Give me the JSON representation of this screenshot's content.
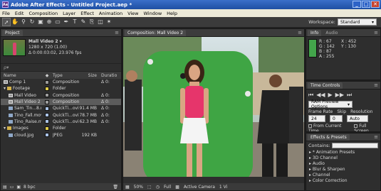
{
  "window": {
    "title": "Adobe After Effects - Untitled Project.aep *",
    "controls": [
      "_",
      "□",
      "✕"
    ]
  },
  "menu": [
    "File",
    "Edit",
    "Composition",
    "Layer",
    "Effect",
    "Animation",
    "View",
    "Window",
    "Help"
  ],
  "toolbar": {
    "tools": [
      "arrow-tool-icon",
      "hand-tool-icon",
      "zoom-tool-icon",
      "rotate-tool-icon",
      "camera-tool-icon",
      "pan-behind-icon",
      "mask-tool-icon",
      "pen-tool-icon",
      "text-tool-icon",
      "brush-tool-icon",
      "clone-tool-icon",
      "eraser-tool-icon",
      "puppet-tool-icon"
    ],
    "workspace_label": "Workspace:",
    "workspace_value": "Standard"
  },
  "project": {
    "tab": "Project",
    "selected_name": "Mall Video 2 ▾",
    "selected_meta": [
      "1280 x 720 (1.00)",
      "Δ 0:00:03:02, 23.976 fps"
    ],
    "search_placeholder": "ρ▾",
    "columns": {
      "name": "Name",
      "type": "Type",
      "size": "Size",
      "duration": "Duratio"
    },
    "rows": [
      {
        "name": "Comp 1",
        "type": "Composition",
        "size": "",
        "duration": "Δ 0:",
        "icon": "comp",
        "label_color": "#9b9b9b",
        "indent": 0,
        "selected": false
      },
      {
        "name": "Footage",
        "type": "Folder",
        "size": "",
        "duration": "",
        "icon": "folder",
        "label_color": "#e0cc48",
        "indent": 0,
        "selected": false
      },
      {
        "name": "Mall Video",
        "type": "Composition",
        "size": "",
        "duration": "Δ 0:",
        "icon": "comp",
        "label_color": "#9b9b9b",
        "indent": 1,
        "selected": false
      },
      {
        "name": "Mall Video 2",
        "type": "Composition",
        "size": "",
        "duration": "Δ 0:",
        "icon": "comp",
        "label_color": "#9b9b9b",
        "indent": 1,
        "selected": true
      },
      {
        "name": "Sam_Tin...8.mov",
        "type": "QuickTi...ovie",
        "size": "91.4 MB",
        "duration": "Δ 0:",
        "icon": "file",
        "label_color": "#a9c2e6",
        "indent": 1,
        "selected": false
      },
      {
        "name": "Tino_Fall.mov",
        "type": "QuickTi...ovie",
        "size": "78.7 MB",
        "duration": "Δ 0:",
        "icon": "file",
        "label_color": "#a9c2e6",
        "indent": 1,
        "selected": false
      },
      {
        "name": "Tino_Raise.mov",
        "type": "QuickTi...ovie",
        "size": "62.3 MB",
        "duration": "Δ 0:",
        "icon": "file",
        "label_color": "#a9c2e6",
        "indent": 1,
        "selected": false
      },
      {
        "name": "Images",
        "type": "Folder",
        "size": "",
        "duration": "",
        "icon": "folder",
        "label_color": "#e0cc48",
        "indent": 0,
        "selected": false
      },
      {
        "name": "cloud.jpg",
        "type": "JPEG",
        "size": "192 KB",
        "duration": "",
        "icon": "file",
        "label_color": "#a9c2e6",
        "indent": 1,
        "selected": false
      }
    ],
    "footer_bpc": "8 bpc"
  },
  "composition": {
    "tab": "Composition: Mall Video 2",
    "footer": {
      "zoom": "50%",
      "quality": "Full",
      "camera": "Active Camera",
      "views": "1 Vi"
    }
  },
  "info": {
    "tabs": [
      "Info",
      "Audio"
    ],
    "rgb": [
      "R : 67",
      "G : 142",
      "B : 87",
      "A : 255"
    ],
    "xy": [
      "X : 452",
      "Y : 130"
    ],
    "swatch": "#43a54b"
  },
  "time_controls": {
    "tab": "Time Controls",
    "preview": "RAM Preview Options",
    "frame_rate_label": "Frame Rate",
    "skip_label": "Skip",
    "resolution_label": "Resolution",
    "frame_rate": "24",
    "skip": "0",
    "resolution": "Auto",
    "from_current": "From Current Time",
    "full_screen": "Full Screen"
  },
  "effects": {
    "tab": "Effects & Presets",
    "contains_label": "Contains:",
    "items": [
      "* Animation Presets",
      "3D Channel",
      "Audio",
      "Blur & Sharpen",
      "Channel",
      "Color Correction"
    ]
  }
}
